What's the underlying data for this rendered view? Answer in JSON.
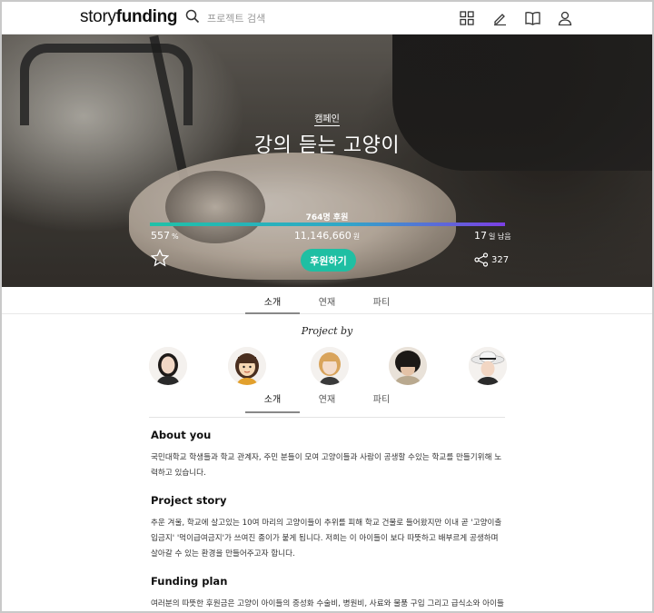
{
  "header": {
    "logo_light": "story",
    "logo_bold": "funding",
    "search_placeholder": "프로젝트 검색",
    "icons": [
      "grid-icon",
      "pencil-icon",
      "book-icon",
      "user-icon"
    ]
  },
  "hero": {
    "category": "캠페인",
    "title": "강의 듣는 고양이",
    "backers": "764명 후원",
    "progress_percent": 557,
    "percent_value": "557",
    "percent_unit": "%",
    "amount_value": "11,146,660",
    "amount_unit": "원",
    "days_value": "17",
    "days_unit": "일 남음",
    "back_button": "후원하기",
    "share_count": "327",
    "colors": {
      "accent": "#1fbfa3",
      "progress_start": "#1fc1a7",
      "progress_end": "#7b3fe4"
    }
  },
  "tabs": [
    {
      "label": "소개",
      "active": true
    },
    {
      "label": "연재",
      "active": false
    },
    {
      "label": "파티",
      "active": false
    }
  ],
  "project_by": "Project by",
  "content": {
    "sections": [
      {
        "title": "About you",
        "body": "국민대학교 학생들과 학교 관계자, 주민 분들이 모여 고양이들과 사람이 공생할 수있는 학교를 만들기위해 노력하고 있습니다."
      },
      {
        "title": "Project story",
        "body": "추운 겨울, 학교에 살고있는 10여 마리의 고양이들이 추위를 피해 학교 건물로 들어왔지만 이내 곧 '고양이출입금지' '먹이급여금지'가 쓰여진 종이가 붙게 됩니다. 저희는 이 아이들이 보다 따뜻하고 배부르게 공생하며 살아갈 수 있는 환경을 만들어주고자 합니다."
      },
      {
        "title": "Funding plan",
        "body": "여러분의 따뜻한 후원금은 고양이 아이들의 중성화 수술비, 병원비, 사료와 물품 구입 그리고 급식소와 아이들의 인식표 제작에 사용됩니다."
      }
    ]
  }
}
